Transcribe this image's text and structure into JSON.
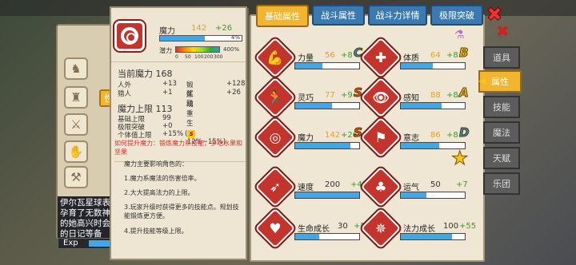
{
  "info": {
    "attr_name": "魔力",
    "attr_base": "142",
    "attr_bonus": "+26",
    "progress_pct": "4%",
    "potential_label": "潜力",
    "potential_ticks": [
      "0",
      "50",
      "100",
      "200",
      "300"
    ],
    "potential_pct": "400%",
    "current_title": "当前魔力 168",
    "current_rows": [
      {
        "l": "人外",
        "v": "+13",
        "l2": "锻炼或重生",
        "v2": "+128"
      },
      {
        "l": "猎人",
        "v": "+1",
        "l2": "奖励",
        "v2": "+26"
      }
    ],
    "limit_title": "魔力上限 113",
    "limit_rows": [
      {
        "l": "基础上限",
        "v": "99"
      },
      {
        "l": "极限突破",
        "v": "+0"
      },
      {
        "l": "个体值上限",
        "v": "+15%",
        "extra": ":12%~15%)"
      }
    ],
    "extra_icon": "S",
    "tip": "如何提升魔力：锻炼魔力系技能，多吃水果和坚果",
    "desc_title": "魔力主要影响角色的：",
    "desc_items": [
      "1.魔力系魔法的伤害倍率。",
      "2.大大提高法力的上限。",
      "3.玩家升级时获得更多的技能点。规划技能锻炼更方便。",
      "4.提升技能等级上限。"
    ]
  },
  "tabs": [
    "基础属性",
    "战斗属性",
    "战斗力详情",
    "极限突破"
  ],
  "stats": [
    {
      "label": "力量",
      "base": "56",
      "bonus": "+8",
      "grade": "C",
      "glyph": "💪",
      "fill": 0.42
    },
    {
      "label": "体质",
      "base": "64",
      "bonus": "+8",
      "grade": "B",
      "glyph": "✚",
      "fill": 0.5
    },
    {
      "label": "灵巧",
      "base": "77",
      "bonus": "+9",
      "grade": "S",
      "glyph": "🏃",
      "fill": 0.58
    },
    {
      "label": "感知",
      "base": "88",
      "bonus": "+8",
      "grade": "A",
      "glyph": "👁",
      "fill": 0.64
    },
    {
      "label": "魔力",
      "base": "142",
      "bonus": "+26",
      "grade": "S",
      "glyph": "◎",
      "fill": 0.86
    },
    {
      "label": "意志",
      "base": "86",
      "bonus": "+8",
      "grade": "D",
      "glyph": "⚑",
      "fill": 0.6
    }
  ],
  "stats2": [
    {
      "label": "速度",
      "val": "200",
      "bonus": "+42",
      "glyph": "➶",
      "fill": 1.0
    },
    {
      "label": "运气",
      "val": "50",
      "bonus": "+7",
      "glyph": "♣",
      "fill": 0.4
    },
    {
      "label": "生命成长",
      "val": "30",
      "bonus": "+51",
      "glyph": "♥",
      "fill": 0.38
    },
    {
      "label": "法力成长",
      "val": "100",
      "bonus": "+55",
      "glyph": "✵",
      "fill": 0.8
    }
  ],
  "side_tabs": [
    "道具",
    "属性",
    "技能",
    "魔法",
    "天赋",
    "乐团"
  ],
  "dialog_text": "伊尔瓦星球表的孕育了无数神秘的她高兴时会轻的日记等备",
  "exp_label": "Exp",
  "left_tab_label": "性",
  "colors": {
    "accent": "#f2b530",
    "tab_blue": "#3a7ab0",
    "stat_red": "#c3342d",
    "bar_blue": "#3fa9e8"
  }
}
